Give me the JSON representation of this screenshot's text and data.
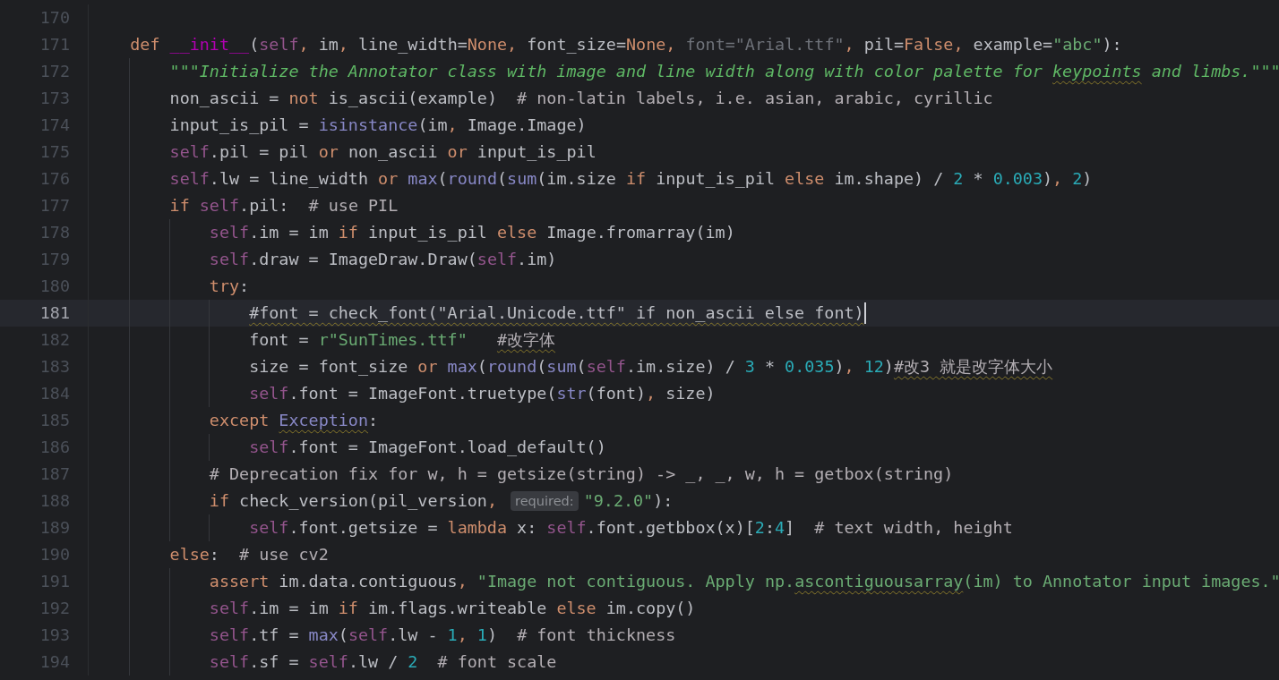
{
  "editor": {
    "lines": [
      {
        "number": "170",
        "current": false
      },
      {
        "number": "171",
        "current": false,
        "tokens": [
          {
            "kind": "keyword",
            "text": "    def "
          },
          {
            "kind": "dunder",
            "text": "__init__"
          },
          {
            "kind": "plain",
            "text": "("
          },
          {
            "kind": "self",
            "text": "self"
          },
          {
            "kind": "punct",
            "text": ", "
          },
          {
            "kind": "plain",
            "text": "im"
          },
          {
            "kind": "punct",
            "text": ", "
          },
          {
            "kind": "plain",
            "text": "line_width="
          },
          {
            "kind": "keyword",
            "text": "None"
          },
          {
            "kind": "punct",
            "text": ", "
          },
          {
            "kind": "plain",
            "text": "font_size="
          },
          {
            "kind": "keyword",
            "text": "None"
          },
          {
            "kind": "punct",
            "text": ", "
          },
          {
            "kind": "unused",
            "text": "font=\"Arial.ttf\""
          },
          {
            "kind": "punct",
            "text": ", "
          },
          {
            "kind": "plain",
            "text": "pil="
          },
          {
            "kind": "keyword",
            "text": "False"
          },
          {
            "kind": "punct",
            "text": ", "
          },
          {
            "kind": "plain",
            "text": "example="
          },
          {
            "kind": "string",
            "text": "\"abc\""
          },
          {
            "kind": "plain",
            "text": "):"
          }
        ]
      },
      {
        "number": "172",
        "current": false,
        "tokens": [
          {
            "kind": "doc",
            "text": "        \"\"\"Initialize the Annotator class with image and line width along with color palette for "
          },
          {
            "kind": "doc-wavy",
            "text": "keypoints"
          },
          {
            "kind": "doc",
            "text": " and limbs.\"\"\""
          }
        ]
      },
      {
        "number": "173",
        "current": false,
        "tokens": [
          {
            "kind": "plain",
            "text": "        non_ascii = "
          },
          {
            "kind": "keyword",
            "text": "not"
          },
          {
            "kind": "plain",
            "text": " is_ascii(example)  "
          },
          {
            "kind": "comment",
            "text": "# non-latin labels, i.e. asian, arabic, cyrillic"
          }
        ]
      },
      {
        "number": "174",
        "current": false,
        "tokens": [
          {
            "kind": "plain",
            "text": "        input_is_pil = "
          },
          {
            "kind": "builtin",
            "text": "isinstance"
          },
          {
            "kind": "plain",
            "text": "(im"
          },
          {
            "kind": "punct",
            "text": ", "
          },
          {
            "kind": "plain",
            "text": "Image.Image)"
          }
        ]
      },
      {
        "number": "175",
        "current": false,
        "tokens": [
          {
            "kind": "self",
            "text": "        self"
          },
          {
            "kind": "plain",
            "text": ".pil = pil "
          },
          {
            "kind": "keyword",
            "text": "or"
          },
          {
            "kind": "plain",
            "text": " non_ascii "
          },
          {
            "kind": "keyword",
            "text": "or"
          },
          {
            "kind": "plain",
            "text": " input_is_pil"
          }
        ]
      },
      {
        "number": "176",
        "current": false,
        "tokens": [
          {
            "kind": "self",
            "text": "        self"
          },
          {
            "kind": "plain",
            "text": ".lw = line_width "
          },
          {
            "kind": "keyword",
            "text": "or "
          },
          {
            "kind": "builtin",
            "text": "max"
          },
          {
            "kind": "plain",
            "text": "("
          },
          {
            "kind": "builtin",
            "text": "round"
          },
          {
            "kind": "plain",
            "text": "("
          },
          {
            "kind": "builtin",
            "text": "sum"
          },
          {
            "kind": "plain",
            "text": "(im.size "
          },
          {
            "kind": "keyword",
            "text": "if"
          },
          {
            "kind": "plain",
            "text": " input_is_pil "
          },
          {
            "kind": "keyword",
            "text": "else"
          },
          {
            "kind": "plain",
            "text": " im.shape) / "
          },
          {
            "kind": "number",
            "text": "2"
          },
          {
            "kind": "plain",
            "text": " * "
          },
          {
            "kind": "number",
            "text": "0.003"
          },
          {
            "kind": "plain",
            "text": ")"
          },
          {
            "kind": "punct",
            "text": ", "
          },
          {
            "kind": "number",
            "text": "2"
          },
          {
            "kind": "plain",
            "text": ")"
          }
        ]
      },
      {
        "number": "177",
        "current": false,
        "tokens": [
          {
            "kind": "keyword",
            "text": "        if "
          },
          {
            "kind": "self",
            "text": "self"
          },
          {
            "kind": "plain",
            "text": ".pil:  "
          },
          {
            "kind": "comment",
            "text": "# use PIL"
          }
        ]
      },
      {
        "number": "178",
        "current": false,
        "tokens": [
          {
            "kind": "self",
            "text": "            self"
          },
          {
            "kind": "plain",
            "text": ".im = im "
          },
          {
            "kind": "keyword",
            "text": "if"
          },
          {
            "kind": "plain",
            "text": " input_is_pil "
          },
          {
            "kind": "keyword",
            "text": "else"
          },
          {
            "kind": "plain",
            "text": " Image.fromarray(im)"
          }
        ]
      },
      {
        "number": "179",
        "current": false,
        "tokens": [
          {
            "kind": "self",
            "text": "            self"
          },
          {
            "kind": "plain",
            "text": ".draw = ImageDraw.Draw("
          },
          {
            "kind": "self",
            "text": "self"
          },
          {
            "kind": "plain",
            "text": ".im)"
          }
        ]
      },
      {
        "number": "180",
        "current": false,
        "tokens": [
          {
            "kind": "keyword",
            "text": "            try"
          },
          {
            "kind": "plain",
            "text": ":"
          }
        ]
      },
      {
        "number": "181",
        "current": true,
        "tokens": [
          {
            "kind": "plain-wavy",
            "text": "                #font = check_font(\"Arial.Unicode.ttf\" if non_ascii else font)"
          }
        ]
      },
      {
        "number": "182",
        "current": false,
        "tokens": [
          {
            "kind": "plain",
            "text": "                font = "
          },
          {
            "kind": "string",
            "text": "r\"SunTimes.ttf\"   "
          },
          {
            "kind": "comment-wavy",
            "text": "#改字体"
          }
        ]
      },
      {
        "number": "183",
        "current": false,
        "tokens": [
          {
            "kind": "plain",
            "text": "                size = font_size "
          },
          {
            "kind": "keyword",
            "text": "or "
          },
          {
            "kind": "builtin",
            "text": "max"
          },
          {
            "kind": "plain",
            "text": "("
          },
          {
            "kind": "builtin",
            "text": "round"
          },
          {
            "kind": "plain",
            "text": "("
          },
          {
            "kind": "builtin",
            "text": "sum"
          },
          {
            "kind": "plain",
            "text": "("
          },
          {
            "kind": "self",
            "text": "self"
          },
          {
            "kind": "plain",
            "text": ".im.size) / "
          },
          {
            "kind": "number",
            "text": "3"
          },
          {
            "kind": "plain",
            "text": " * "
          },
          {
            "kind": "number",
            "text": "0.035"
          },
          {
            "kind": "plain",
            "text": ")"
          },
          {
            "kind": "punct",
            "text": ", "
          },
          {
            "kind": "number",
            "text": "12"
          },
          {
            "kind": "plain",
            "text": ")"
          },
          {
            "kind": "comment-wavy",
            "text": "#改3 就是改字体大小"
          }
        ]
      },
      {
        "number": "184",
        "current": false,
        "tokens": [
          {
            "kind": "self",
            "text": "                self"
          },
          {
            "kind": "plain",
            "text": ".font = ImageFont.truetype("
          },
          {
            "kind": "builtin",
            "text": "str"
          },
          {
            "kind": "plain",
            "text": "(font)"
          },
          {
            "kind": "punct",
            "text": ", "
          },
          {
            "kind": "plain",
            "text": "size)"
          }
        ]
      },
      {
        "number": "185",
        "current": false,
        "tokens": [
          {
            "kind": "keyword",
            "text": "            except "
          },
          {
            "kind": "builtin-wavy",
            "text": "Exception"
          },
          {
            "kind": "plain",
            "text": ":"
          }
        ]
      },
      {
        "number": "186",
        "current": false,
        "tokens": [
          {
            "kind": "self",
            "text": "                self"
          },
          {
            "kind": "plain",
            "text": ".font = ImageFont.load_default()"
          }
        ]
      },
      {
        "number": "187",
        "current": false,
        "tokens": [
          {
            "kind": "comment",
            "text": "            # Deprecation fix for w, h = getsize(string) -> _, _, w, h = getbox(string)"
          }
        ]
      },
      {
        "number": "188",
        "current": false,
        "tokens": [
          {
            "kind": "keyword",
            "text": "            if "
          },
          {
            "kind": "plain",
            "text": "check_version(pil_version"
          },
          {
            "kind": "punct",
            "text": ", "
          },
          {
            "kind": "hint",
            "text": "required:"
          },
          {
            "kind": "string",
            "text": "\"9.2.0\""
          },
          {
            "kind": "plain",
            "text": "):"
          }
        ]
      },
      {
        "number": "189",
        "current": false,
        "tokens": [
          {
            "kind": "self",
            "text": "                self"
          },
          {
            "kind": "plain",
            "text": ".font.getsize = "
          },
          {
            "kind": "keyword",
            "text": "lambda"
          },
          {
            "kind": "plain",
            "text": " x: "
          },
          {
            "kind": "self",
            "text": "self"
          },
          {
            "kind": "plain",
            "text": ".font.getbbox(x)["
          },
          {
            "kind": "number",
            "text": "2"
          },
          {
            "kind": "plain",
            "text": ":"
          },
          {
            "kind": "number",
            "text": "4"
          },
          {
            "kind": "plain",
            "text": "]  "
          },
          {
            "kind": "comment",
            "text": "# text width, height"
          }
        ]
      },
      {
        "number": "190",
        "current": false,
        "tokens": [
          {
            "kind": "keyword",
            "text": "        else"
          },
          {
            "kind": "plain",
            "text": ":  "
          },
          {
            "kind": "comment",
            "text": "# use cv2"
          }
        ]
      },
      {
        "number": "191",
        "current": false,
        "tokens": [
          {
            "kind": "keyword",
            "text": "            assert"
          },
          {
            "kind": "plain",
            "text": " im.data.contiguous"
          },
          {
            "kind": "punct",
            "text": ", "
          },
          {
            "kind": "string",
            "text": "\"Image not contiguous. Apply np."
          },
          {
            "kind": "string-wavy",
            "text": "ascontiguousarray"
          },
          {
            "kind": "string",
            "text": "(im) to Annotator input images.\""
          }
        ]
      },
      {
        "number": "192",
        "current": false,
        "tokens": [
          {
            "kind": "self",
            "text": "            self"
          },
          {
            "kind": "plain",
            "text": ".im = im "
          },
          {
            "kind": "keyword",
            "text": "if"
          },
          {
            "kind": "plain",
            "text": " im.flags.writeable "
          },
          {
            "kind": "keyword",
            "text": "else"
          },
          {
            "kind": "plain",
            "text": " im.copy()"
          }
        ]
      },
      {
        "number": "193",
        "current": false,
        "tokens": [
          {
            "kind": "self",
            "text": "            self"
          },
          {
            "kind": "plain",
            "text": ".tf = "
          },
          {
            "kind": "builtin",
            "text": "max"
          },
          {
            "kind": "plain",
            "text": "("
          },
          {
            "kind": "self",
            "text": "self"
          },
          {
            "kind": "plain",
            "text": ".lw - "
          },
          {
            "kind": "number",
            "text": "1"
          },
          {
            "kind": "punct",
            "text": ", "
          },
          {
            "kind": "number",
            "text": "1"
          },
          {
            "kind": "plain",
            "text": ")  "
          },
          {
            "kind": "comment",
            "text": "# font thickness"
          }
        ]
      },
      {
        "number": "194",
        "current": false,
        "tokens": [
          {
            "kind": "self",
            "text": "            self"
          },
          {
            "kind": "plain",
            "text": ".sf = "
          },
          {
            "kind": "self",
            "text": "self"
          },
          {
            "kind": "plain",
            "text": ".lw / "
          },
          {
            "kind": "number",
            "text": "2  "
          },
          {
            "kind": "comment",
            "text": "# font scale"
          }
        ]
      }
    ]
  }
}
